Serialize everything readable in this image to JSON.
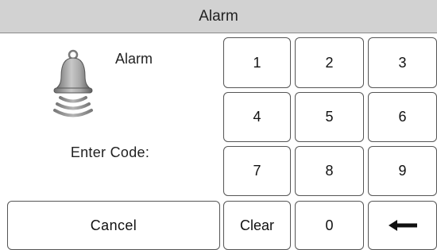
{
  "window": {
    "title": "Alarm"
  },
  "panel": {
    "alarm_label": "Alarm",
    "bell_icon": "alarm-bell-icon",
    "prompt": "Enter Code:"
  },
  "keypad": {
    "k1": "1",
    "k2": "2",
    "k3": "3",
    "k4": "4",
    "k5": "5",
    "k6": "6",
    "k7": "7",
    "k8": "8",
    "k9": "9",
    "k0": "0",
    "clear": "Clear",
    "backspace_icon": "left-arrow-icon"
  },
  "actions": {
    "cancel": "Cancel"
  },
  "colors": {
    "titlebar_bg": "#d2d2d2",
    "key_border": "#555555",
    "bell_metal": "#9a9a9a"
  }
}
